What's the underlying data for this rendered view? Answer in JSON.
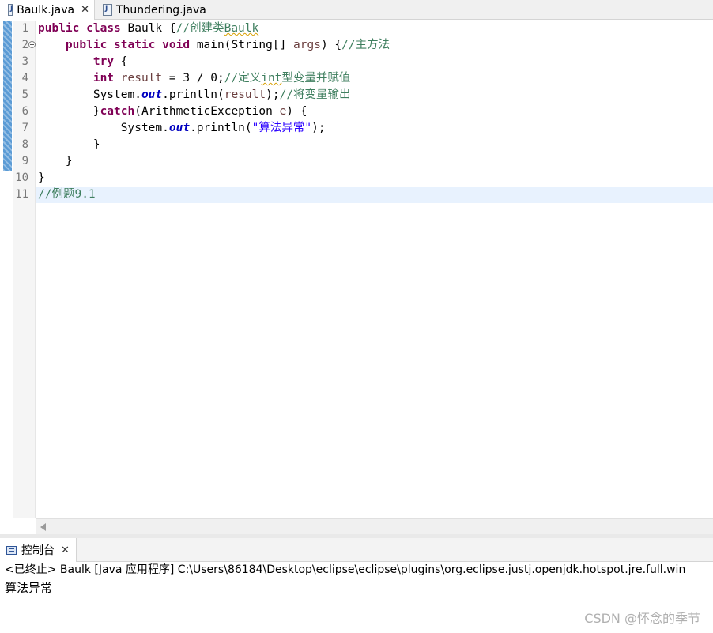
{
  "editor_tabs": [
    {
      "label": "Baulk.java",
      "active": true,
      "icon": "java-file-icon"
    },
    {
      "label": "Thundering.java",
      "active": false,
      "icon": "java-file-icon"
    }
  ],
  "tab_close_glyph": "✕",
  "line_numbers": [
    "1",
    "2",
    "3",
    "4",
    "5",
    "6",
    "7",
    "8",
    "9",
    "10",
    "11"
  ],
  "fold_marker": "⊖",
  "code": {
    "l1": {
      "kw1": "public",
      "kw2": "class",
      "name": " Baulk {",
      "comment": "//创建类",
      "comment_word": "Baulk"
    },
    "l2": {
      "indent": "    ",
      "kw1": "public",
      "kw2": "static",
      "kw3": "void",
      "sig": " main(String[] ",
      "param": "args",
      "tail": ") {",
      "comment": "//主方法"
    },
    "l3": {
      "indent": "        ",
      "kw": "try",
      "tail": " {"
    },
    "l4": {
      "indent": "        ",
      "kw": "int",
      "sp": " ",
      "var": "result",
      "expr": " = 3 / 0;",
      "comment_a": "//定义",
      "comment_word": "int",
      "comment_b": "型变量并赋值"
    },
    "l5": {
      "indent": "        ",
      "pre": "System.",
      "field": "out",
      "mid": ".println(",
      "var": "result",
      "tail": ");",
      "comment": "//将变量输出"
    },
    "l6": {
      "indent": "        ",
      "pre": "}",
      "kw": "catch",
      "mid": "(ArithmeticException ",
      "param": "e",
      "tail": ") {"
    },
    "l7": {
      "indent": "            ",
      "pre": "System.",
      "field": "out",
      "mid": ".println(",
      "str": "\"算法异常\"",
      "tail": ");"
    },
    "l8": {
      "indent": "        ",
      "text": "}"
    },
    "l9": {
      "indent": "    ",
      "text": "}"
    },
    "l10": {
      "text": "}"
    },
    "l11": {
      "comment": "//例题9.1"
    }
  },
  "console": {
    "tab_label": "控制台",
    "tab_icon": "console-icon",
    "status": "<已终止> Baulk [Java 应用程序] C:\\Users\\86184\\Desktop\\eclipse\\eclipse\\plugins\\org.eclipse.justj.openjdk.hotspot.jre.full.win",
    "output": "算法异常"
  },
  "watermark": "CSDN @怀念的季节",
  "colors": {
    "keyword": "#7f0055",
    "comment": "#3f7f5f",
    "local_variable": "#6a3e3e",
    "static_field": "#0000c0",
    "string": "#2a00ff",
    "current_line": "#e8f2fe",
    "quick_diff": "#5b9bd5"
  }
}
